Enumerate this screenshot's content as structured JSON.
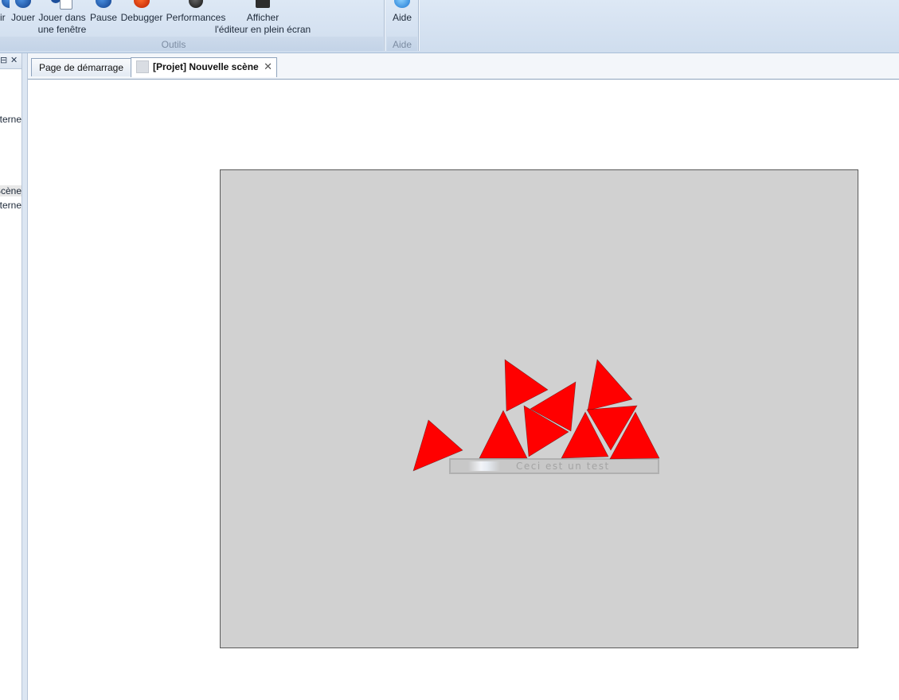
{
  "ribbon": {
    "buttons": [
      {
        "label": "ir",
        "icon": "play-icon"
      },
      {
        "label": "Jouer",
        "icon": "play-icon"
      },
      {
        "label_line1": "Jouer dans",
        "label_line2": "une fenêtre",
        "icon": "window-icon"
      },
      {
        "label": "Pause",
        "icon": "pause-icon"
      },
      {
        "label": "Debugger",
        "icon": "bug-icon"
      },
      {
        "label": "Performances",
        "icon": "gauge-icon"
      },
      {
        "label_line1": "Afficher",
        "label_line2": "l'éditeur en plein écran",
        "icon": "fullscreen-icon"
      },
      {
        "label": "Aide",
        "icon": "help-icon"
      }
    ],
    "groups": {
      "tools": "Outils",
      "help": "Aide"
    }
  },
  "left_panel": {
    "controls": [
      "⊟",
      "✕"
    ],
    "items": [
      {
        "text": "Externe"
      },
      {
        "text": "Scène",
        "selected": true
      },
      {
        "text": "Externe"
      }
    ]
  },
  "tabs": [
    {
      "label": "Page de démarrage",
      "active": false
    },
    {
      "label": "[Projet] Nouvelle scène",
      "active": true,
      "close": "✕"
    }
  ],
  "scene": {
    "background_color": "#d1d1d1",
    "object_color": "#ff0000",
    "text_object": "Ceci est un test"
  }
}
